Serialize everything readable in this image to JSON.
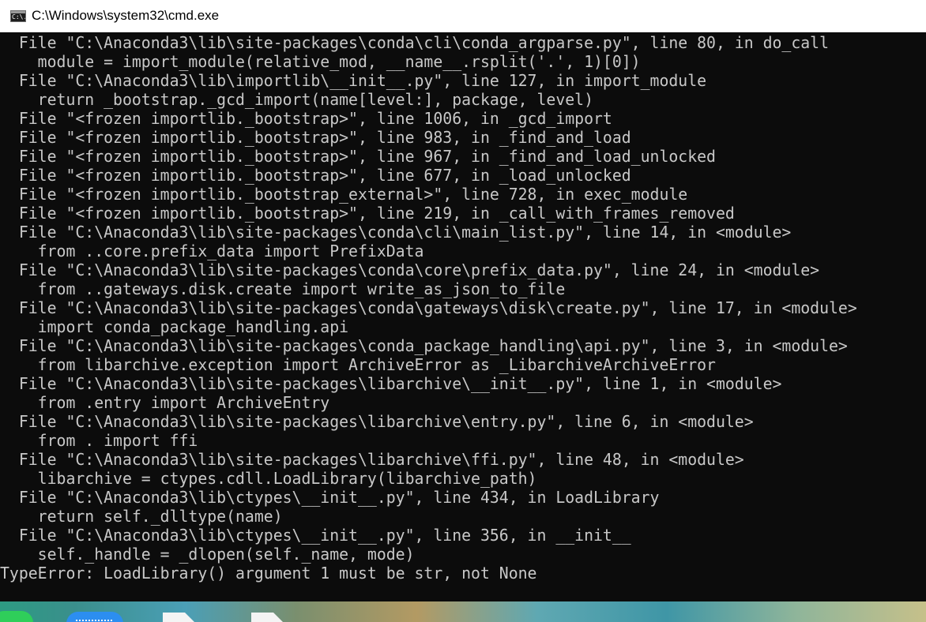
{
  "window": {
    "title": "C:\\Windows\\system32\\cmd.exe",
    "icon": "cmd-icon",
    "icon_text": "C:\\."
  },
  "console": {
    "lines": [
      "  File \"C:\\Anaconda3\\lib\\site-packages\\conda\\cli\\conda_argparse.py\", line 80, in do_call",
      "    module = import_module(relative_mod, __name__.rsplit('.', 1)[0])",
      "  File \"C:\\Anaconda3\\lib\\importlib\\__init__.py\", line 127, in import_module",
      "    return _bootstrap._gcd_import(name[level:], package, level)",
      "  File \"<frozen importlib._bootstrap>\", line 1006, in _gcd_import",
      "  File \"<frozen importlib._bootstrap>\", line 983, in _find_and_load",
      "  File \"<frozen importlib._bootstrap>\", line 967, in _find_and_load_unlocked",
      "  File \"<frozen importlib._bootstrap>\", line 677, in _load_unlocked",
      "  File \"<frozen importlib._bootstrap_external>\", line 728, in exec_module",
      "  File \"<frozen importlib._bootstrap>\", line 219, in _call_with_frames_removed",
      "  File \"C:\\Anaconda3\\lib\\site-packages\\conda\\cli\\main_list.py\", line 14, in <module>",
      "    from ..core.prefix_data import PrefixData",
      "  File \"C:\\Anaconda3\\lib\\site-packages\\conda\\core\\prefix_data.py\", line 24, in <module>",
      "    from ..gateways.disk.create import write_as_json_to_file",
      "  File \"C:\\Anaconda3\\lib\\site-packages\\conda\\gateways\\disk\\create.py\", line 17, in <module>",
      "    import conda_package_handling.api",
      "  File \"C:\\Anaconda3\\lib\\site-packages\\conda_package_handling\\api.py\", line 3, in <module>",
      "    from libarchive.exception import ArchiveError as _LibarchiveArchiveError",
      "  File \"C:\\Anaconda3\\lib\\site-packages\\libarchive\\__init__.py\", line 1, in <module>",
      "    from .entry import ArchiveEntry",
      "  File \"C:\\Anaconda3\\lib\\site-packages\\libarchive\\entry.py\", line 6, in <module>",
      "    from . import ffi",
      "  File \"C:\\Anaconda3\\lib\\site-packages\\libarchive\\ffi.py\", line 48, in <module>",
      "    libarchive = ctypes.cdll.LoadLibrary(libarchive_path)",
      "  File \"C:\\Anaconda3\\lib\\ctypes\\__init__.py\", line 434, in LoadLibrary",
      "    return self._dlltype(name)",
      "  File \"C:\\Anaconda3\\lib\\ctypes\\__init__.py\", line 356, in __init__",
      "    self._handle = _dlopen(self._name, mode)",
      "TypeError: LoadLibrary() argument 1 must be str, not None"
    ]
  },
  "colors": {
    "console_background": "#0c0c0c",
    "console_text": "#c8c8c8",
    "titlebar_background": "#ffffff"
  }
}
